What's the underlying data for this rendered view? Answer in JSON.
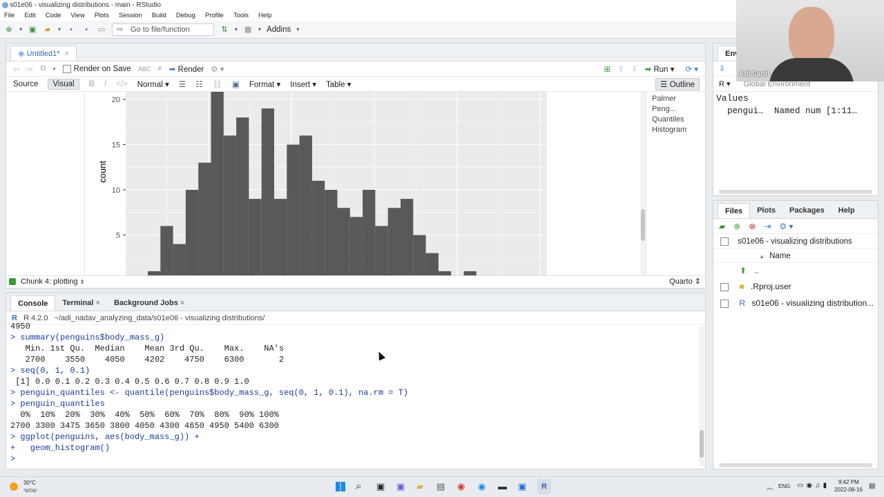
{
  "window": {
    "title": "s01e06 - visualizing distributions - main - RStudio"
  },
  "menu": [
    "File",
    "Edit",
    "Code",
    "View",
    "Plots",
    "Session",
    "Build",
    "Debug",
    "Profile",
    "Tools",
    "Help"
  ],
  "toolbar": {
    "goto_placeholder": "Go to file/function",
    "addins": "Addins"
  },
  "editor": {
    "tab_label": "Untitled1*",
    "render_on_save": "Render on Save",
    "render": "Render",
    "run": "Run",
    "source": "Source",
    "visual": "Visual",
    "normal": "Normal",
    "format": "Format",
    "insert": "Insert",
    "table": "Table",
    "outline": "Outline",
    "outline_items": [
      "Palmer Peng...",
      "Quantiles",
      "Histogram"
    ],
    "chunk_status": "Chunk 4: plotting",
    "doc_type": "Quarto"
  },
  "chart_data": {
    "type": "bar",
    "ylabel": "count",
    "ylim": [
      0,
      21
    ],
    "yticks": [
      5,
      10,
      15,
      20
    ],
    "values": [
      1,
      6,
      4,
      10,
      13,
      27,
      16,
      18,
      9,
      19,
      9,
      15,
      16,
      11,
      10,
      8,
      7,
      10,
      6,
      8,
      9,
      5,
      3,
      1,
      0,
      1
    ]
  },
  "console": {
    "tabs": [
      "Console",
      "Terminal",
      "Background Jobs"
    ],
    "r_version": "R 4.2.0",
    "path": "~/adi_nadav_analyzing_data/s01e06 - visualizing distributions/",
    "lines": [
      {
        "t": "4950",
        "c": "out"
      },
      {
        "t": "> summary(penguins$body_mass_g)",
        "c": "cmd"
      },
      {
        "t": "   Min. 1st Qu.  Median    Mean 3rd Qu.    Max.    NA's ",
        "c": "out"
      },
      {
        "t": "   2700    3550    4050    4202    4750    6300       2 ",
        "c": "out"
      },
      {
        "t": "> seq(0, 1, 0.1)",
        "c": "cmd"
      },
      {
        "t": " [1] 0.0 0.1 0.2 0.3 0.4 0.5 0.6 0.7 0.8 0.9 1.0",
        "c": "out"
      },
      {
        "t": "> penguin_quantiles <- quantile(penguins$body_mass_g, seq(0, 1, 0.1), na.rm = T)",
        "c": "cmd"
      },
      {
        "t": "> penguin_quantiles",
        "c": "cmd"
      },
      {
        "t": "  0%  10%  20%  30%  40%  50%  60%  70%  80%  90% 100% ",
        "c": "out"
      },
      {
        "t": "2700 3300 3475 3650 3800 4050 4300 4650 4950 5400 6300 ",
        "c": "out"
      },
      {
        "t": "> ggplot(penguins, aes(body_mass_g)) +",
        "c": "cmd"
      },
      {
        "t": "+   geom_histogram()",
        "c": "cmd"
      },
      {
        "t": "> ",
        "c": "cmd"
      }
    ]
  },
  "environment": {
    "tab": "Envir",
    "scope": "Global Environment",
    "r_label": "R",
    "values_header": "Values",
    "var_name": "pengui…",
    "var_value": "Named num [1:11…"
  },
  "files": {
    "tabs": [
      "Files",
      "Plots",
      "Packages",
      "Help"
    ],
    "breadcrumb": "s01e06 - visualizing distributions",
    "col_name": "Name",
    "up": "..",
    "items": [
      ".Rproj.user",
      "s01e06 - visualizing distribution..."
    ]
  },
  "webcam": {
    "name": "Adi Sarid"
  },
  "taskbar": {
    "temp": "30°C",
    "weather": "שמשי",
    "lang": "ENG",
    "time": "9:42 PM",
    "date": "2022-08-16"
  }
}
